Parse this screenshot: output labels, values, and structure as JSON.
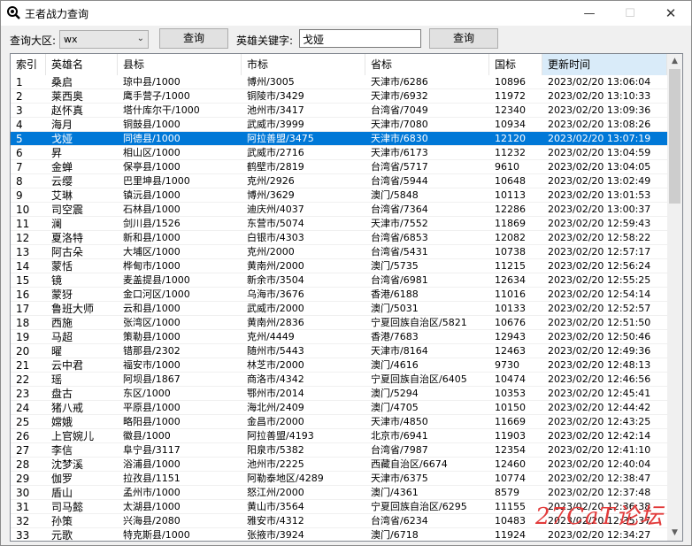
{
  "window": {
    "title": "王者战力查询"
  },
  "toolbar": {
    "region_label": "查询大区:",
    "region_value": "wx",
    "query_button": "查询",
    "keyword_label": "英雄关键字:",
    "keyword_value": "戈娅",
    "query_button_2": "查询"
  },
  "table": {
    "columns": [
      "索引",
      "英雄名",
      "县标",
      "市标",
      "省标",
      "国标",
      "更新时间"
    ],
    "selected_row": 4,
    "rows": [
      [
        "1",
        "桑启",
        "琼中县/1000",
        "博州/3005",
        "天津市/6286",
        "10896",
        "2023/02/20 13:06:04"
      ],
      [
        "2",
        "莱西奥",
        "鹰手营子/1000",
        "铜陵市/3429",
        "天津市/6932",
        "11972",
        "2023/02/20 13:10:33"
      ],
      [
        "3",
        "赵怀真",
        "塔什库尔干/1000",
        "池州市/3417",
        "台湾省/7049",
        "12340",
        "2023/02/20 13:09:36"
      ],
      [
        "4",
        "海月",
        "铜鼓县/1000",
        "武威市/3999",
        "天津市/7080",
        "10934",
        "2023/02/20 13:08:26"
      ],
      [
        "5",
        "戈娅",
        "同德县/1000",
        "阿拉善盟/3475",
        "天津市/6830",
        "12120",
        "2023/02/20 13:07:19"
      ],
      [
        "6",
        "昇",
        "相山区/1000",
        "武威市/2716",
        "天津市/6173",
        "11232",
        "2023/02/20 13:04:59"
      ],
      [
        "7",
        "金蝉",
        "保亭县/1000",
        "鹤壁市/2819",
        "台湾省/5717",
        "9610",
        "2023/02/20 13:04:05"
      ],
      [
        "8",
        "云缨",
        "巴里坤县/1000",
        "克州/2926",
        "台湾省/5944",
        "10648",
        "2023/02/20 13:02:49"
      ],
      [
        "9",
        "艾琳",
        "镇沅县/1000",
        "博州/3629",
        "澳门/5848",
        "10113",
        "2023/02/20 13:01:53"
      ],
      [
        "10",
        "司空震",
        "石林县/1000",
        "迪庆州/4037",
        "台湾省/7364",
        "12286",
        "2023/02/20 13:00:37"
      ],
      [
        "11",
        "澜",
        "剑川县/1526",
        "东营市/5074",
        "天津市/7552",
        "11869",
        "2023/02/20 12:59:43"
      ],
      [
        "12",
        "夏洛特",
        "新和县/1000",
        "白银市/4303",
        "台湾省/6853",
        "12082",
        "2023/02/20 12:58:22"
      ],
      [
        "13",
        "阿古朵",
        "大埔区/1000",
        "克州/2000",
        "台湾省/5431",
        "10738",
        "2023/02/20 12:57:17"
      ],
      [
        "14",
        "蒙恬",
        "桦甸市/1000",
        "黄南州/2000",
        "澳门/5735",
        "11215",
        "2023/02/20 12:56:24"
      ],
      [
        "15",
        "镜",
        "麦盖提县/1000",
        "新余市/3504",
        "台湾省/6981",
        "12634",
        "2023/02/20 12:55:25"
      ],
      [
        "16",
        "蒙犽",
        "金口河区/1000",
        "乌海市/3676",
        "香港/6188",
        "11016",
        "2023/02/20 12:54:14"
      ],
      [
        "17",
        "鲁班大师",
        "云和县/1000",
        "武威市/2000",
        "澳门/5031",
        "10133",
        "2023/02/20 12:52:57"
      ],
      [
        "18",
        "西施",
        "张湾区/1000",
        "黄南州/2836",
        "宁夏回族自治区/5821",
        "10676",
        "2023/02/20 12:51:50"
      ],
      [
        "19",
        "马超",
        "策勒县/1000",
        "克州/4449",
        "香港/7683",
        "12943",
        "2023/02/20 12:50:46"
      ],
      [
        "20",
        "曜",
        "错那县/2302",
        "随州市/5443",
        "天津市/8164",
        "12463",
        "2023/02/20 12:49:36"
      ],
      [
        "21",
        "云中君",
        "福安市/1000",
        "林芝市/2000",
        "澳门/4616",
        "9730",
        "2023/02/20 12:48:13"
      ],
      [
        "22",
        "瑶",
        "阿坝县/1867",
        "商洛市/4342",
        "宁夏回族自治区/6405",
        "10474",
        "2023/02/20 12:46:56"
      ],
      [
        "23",
        "盘古",
        "东区/1000",
        "鄂州市/2014",
        "澳门/5294",
        "10353",
        "2023/02/20 12:45:41"
      ],
      [
        "24",
        "猪八戒",
        "平原县/1000",
        "海北州/2409",
        "澳门/4705",
        "10150",
        "2023/02/20 12:44:42"
      ],
      [
        "25",
        "嫦娥",
        "略阳县/1000",
        "金昌市/2000",
        "天津市/4850",
        "11669",
        "2023/02/20 12:43:25"
      ],
      [
        "26",
        "上官婉儿",
        "徽县/1000",
        "阿拉善盟/4193",
        "北京市/6941",
        "11903",
        "2023/02/20 12:42:14"
      ],
      [
        "27",
        "李信",
        "阜宁县/3117",
        "阳泉市/5382",
        "台湾省/7987",
        "12354",
        "2023/02/20 12:41:10"
      ],
      [
        "28",
        "沈梦溪",
        "浴浦县/1000",
        "池州市/2225",
        "西藏自治区/6674",
        "12460",
        "2023/02/20 12:40:04"
      ],
      [
        "29",
        "伽罗",
        "拉孜县/1151",
        "阿勒泰地区/4289",
        "天津市/6375",
        "10774",
        "2023/02/20 12:38:47"
      ],
      [
        "30",
        "盾山",
        "孟州市/1000",
        "怒江州/2000",
        "澳门/4361",
        "8579",
        "2023/02/20 12:37:48"
      ],
      [
        "31",
        "司马懿",
        "太湖县/1000",
        "黄山市/3564",
        "宁夏回族自治区/6295",
        "11155",
        "2023/02/20 12:36:38"
      ],
      [
        "32",
        "孙策",
        "兴海县/2080",
        "雅安市/4312",
        "台湾省/6234",
        "10483",
        "2023/02/20 12:35:37"
      ],
      [
        "33",
        "元歌",
        "特克斯县/1000",
        "张掖市/3924",
        "澳门/6718",
        "11924",
        "2023/02/20 12:34:27"
      ]
    ]
  },
  "watermark": {
    "text": "27CaT论坛"
  }
}
